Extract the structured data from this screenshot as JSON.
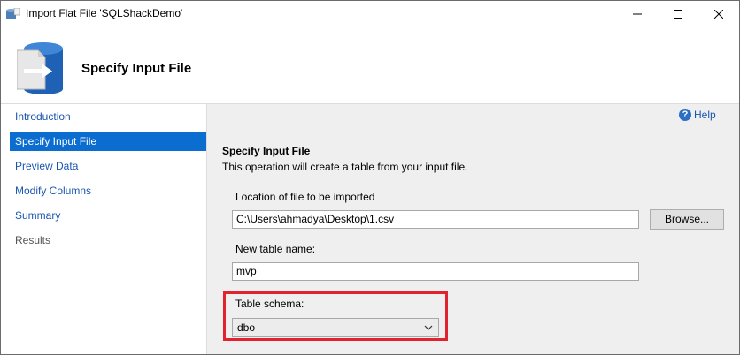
{
  "window": {
    "title": "Import Flat File 'SQLShackDemo'",
    "controls": {
      "minimize_icon": "minimize-icon",
      "maximize_icon": "maximize-icon",
      "close_icon": "close-icon"
    }
  },
  "header": {
    "title": "Specify Input File",
    "icon": "import-file-icon"
  },
  "nav": {
    "items": [
      {
        "label": "Introduction",
        "state": "link"
      },
      {
        "label": "Specify Input File",
        "state": "selected"
      },
      {
        "label": "Preview Data",
        "state": "link"
      },
      {
        "label": "Modify Columns",
        "state": "link"
      },
      {
        "label": "Summary",
        "state": "link"
      },
      {
        "label": "Results",
        "state": "disabled"
      }
    ]
  },
  "main": {
    "help_label": "Help",
    "section_title": "Specify Input File",
    "section_description": "This operation will create a table from your input file.",
    "file_location": {
      "label": "Location of file to be imported",
      "value": "C:\\Users\\ahmadya\\Desktop\\1.csv",
      "browse_label": "Browse..."
    },
    "table_name": {
      "label": "New table name:",
      "value": "mvp"
    },
    "table_schema": {
      "label": "Table schema:",
      "selected": "dbo",
      "highlighted": true
    }
  },
  "colors": {
    "selection": "#0c6dd1",
    "link": "#1a56b0",
    "highlight_border": "#e0232e",
    "pane_background": "#efefef"
  }
}
